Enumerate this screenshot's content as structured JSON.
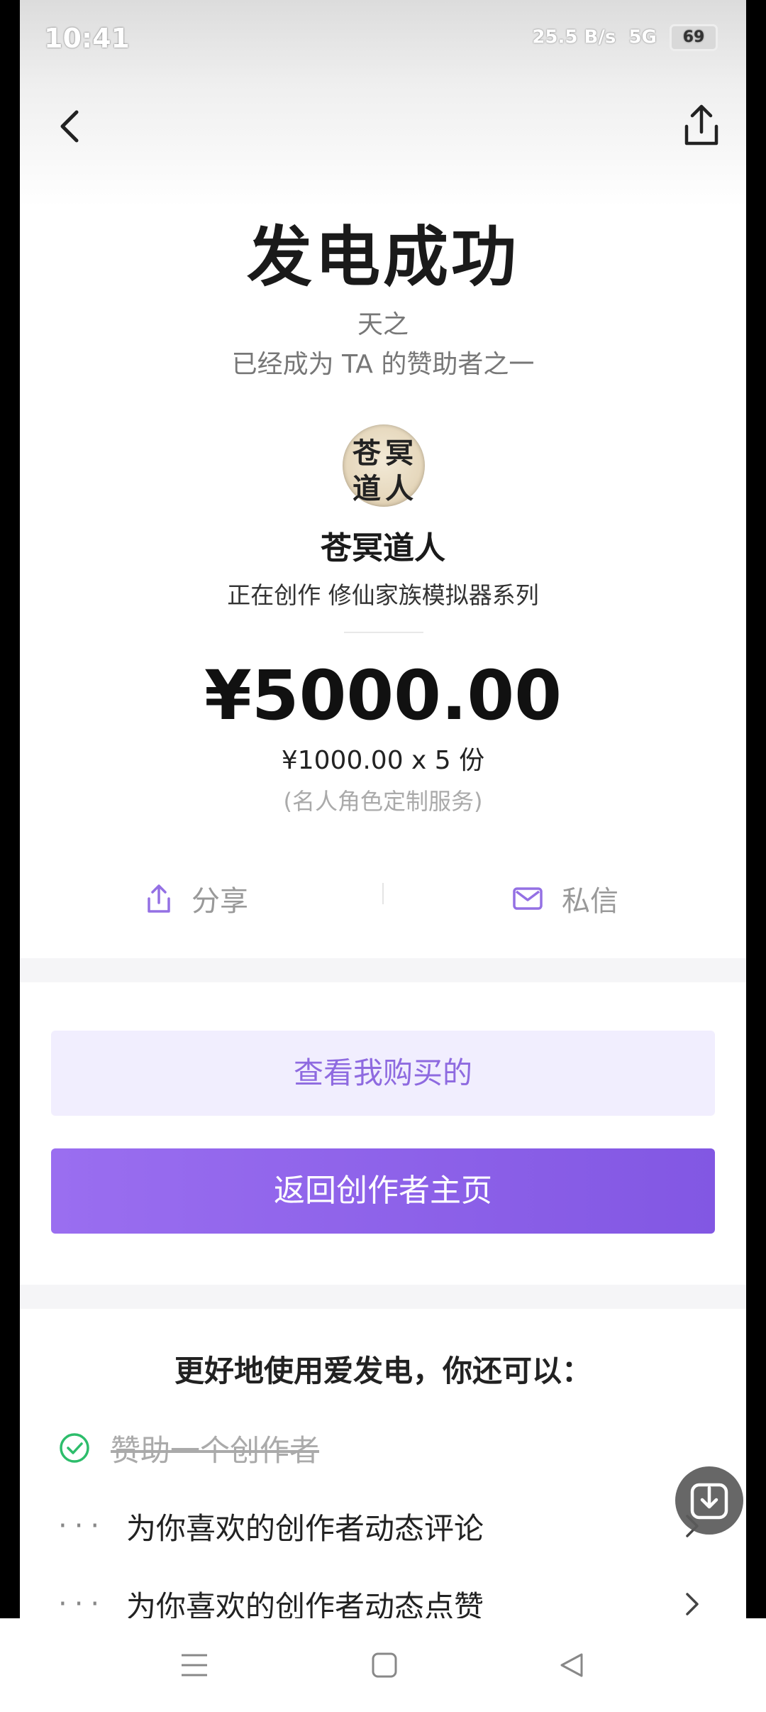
{
  "status": {
    "time": "10:41",
    "network_speed": "25.5 B/s",
    "signal": "5G",
    "battery": "69"
  },
  "header": {
    "back_icon": "chevron-left-icon",
    "share_icon": "share-upload-icon"
  },
  "result": {
    "title": "发电成功",
    "sponsor_name": "天之",
    "sponsor_desc": "已经成为 TA 的赞助者之一"
  },
  "creator": {
    "avatar_text": [
      "苍",
      "冥",
      "道",
      "人"
    ],
    "name": "苍冥道人",
    "creating": "正在创作 修仙家族模拟器系列"
  },
  "payment": {
    "amount": "¥5000.00",
    "unit_line": "¥1000.00 x 5 份",
    "service": "(名人角色定制服务)"
  },
  "actions": {
    "share_label": "分享",
    "message_label": "私信"
  },
  "buttons": {
    "view_purchases": "查看我购买的",
    "back_to_creator": "返回创作者主页"
  },
  "more": {
    "title": "更好地使用爱发电，你还可以：",
    "tasks": [
      {
        "label": "赞助一个创作者",
        "done": true
      },
      {
        "label": "为你喜欢的创作者动态评论",
        "done": false
      },
      {
        "label": "为你喜欢的创作者动态点赞",
        "done": false
      }
    ]
  },
  "colors": {
    "accent": "#8e6ae0",
    "primary_button": "#8a60e8",
    "light_button_bg": "#f1eefe",
    "done_check": "#2dbd6b"
  }
}
